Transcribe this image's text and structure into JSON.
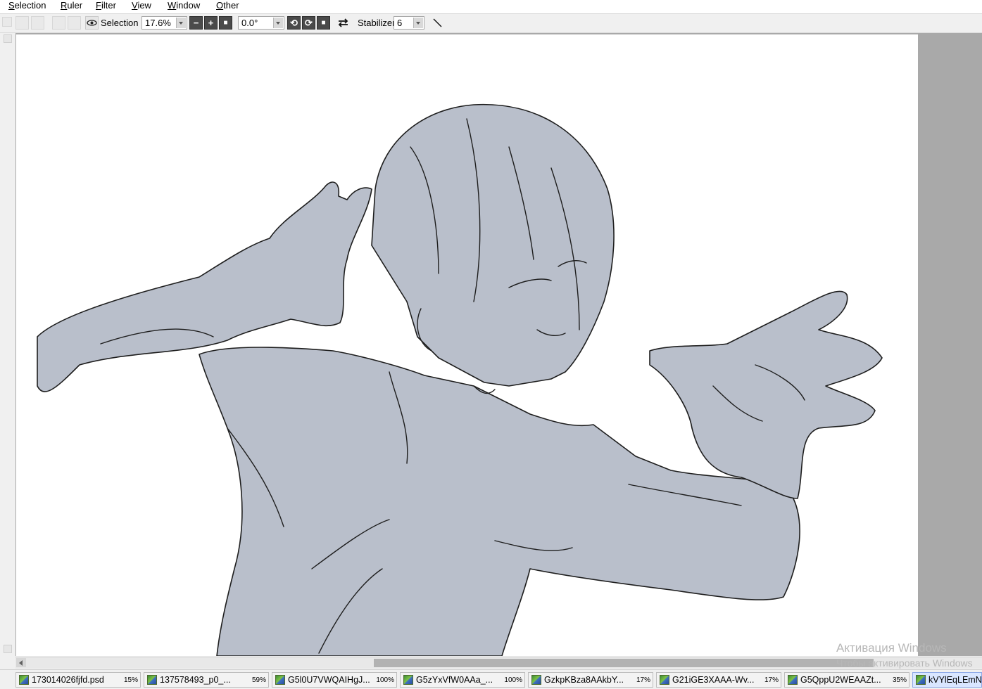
{
  "menubar": {
    "items": [
      "Selection",
      "Ruler",
      "Filter",
      "View",
      "Window",
      "Other"
    ]
  },
  "toolbar": {
    "selection_label": "Selection",
    "zoom_value": "17.6%",
    "rotation_value": "0.0°",
    "stabilizer_label": "Stabilizer",
    "stabilizer_value": "6"
  },
  "canvas": {
    "content": "line-art sketch of a character with short hair and outstretched hands",
    "fill_color": "#b9bfcb",
    "line_color": "#1e1e1e"
  },
  "tabs": [
    {
      "name": "173014026fjfd.psd",
      "zoom": "15%"
    },
    {
      "name": "137578493_p0_...",
      "zoom": "59%"
    },
    {
      "name": "G5l0U7VWQAIHgJ...",
      "zoom": "100%"
    },
    {
      "name": "G5zYxVfW0AAa_...",
      "zoom": "100%"
    },
    {
      "name": "GzkpKBza8AAkbY...",
      "zoom": "17%"
    },
    {
      "name": "G21iGE3XAAA-Wv...",
      "zoom": "17%"
    },
    {
      "name": "G5QppU2WEAAZt...",
      "zoom": "35%"
    },
    {
      "name": "kVYlEqLEmNV",
      "zoom": ""
    }
  ],
  "watermark": {
    "line1": "Активация Windows",
    "line2": "Чтобы активировать Windows"
  }
}
